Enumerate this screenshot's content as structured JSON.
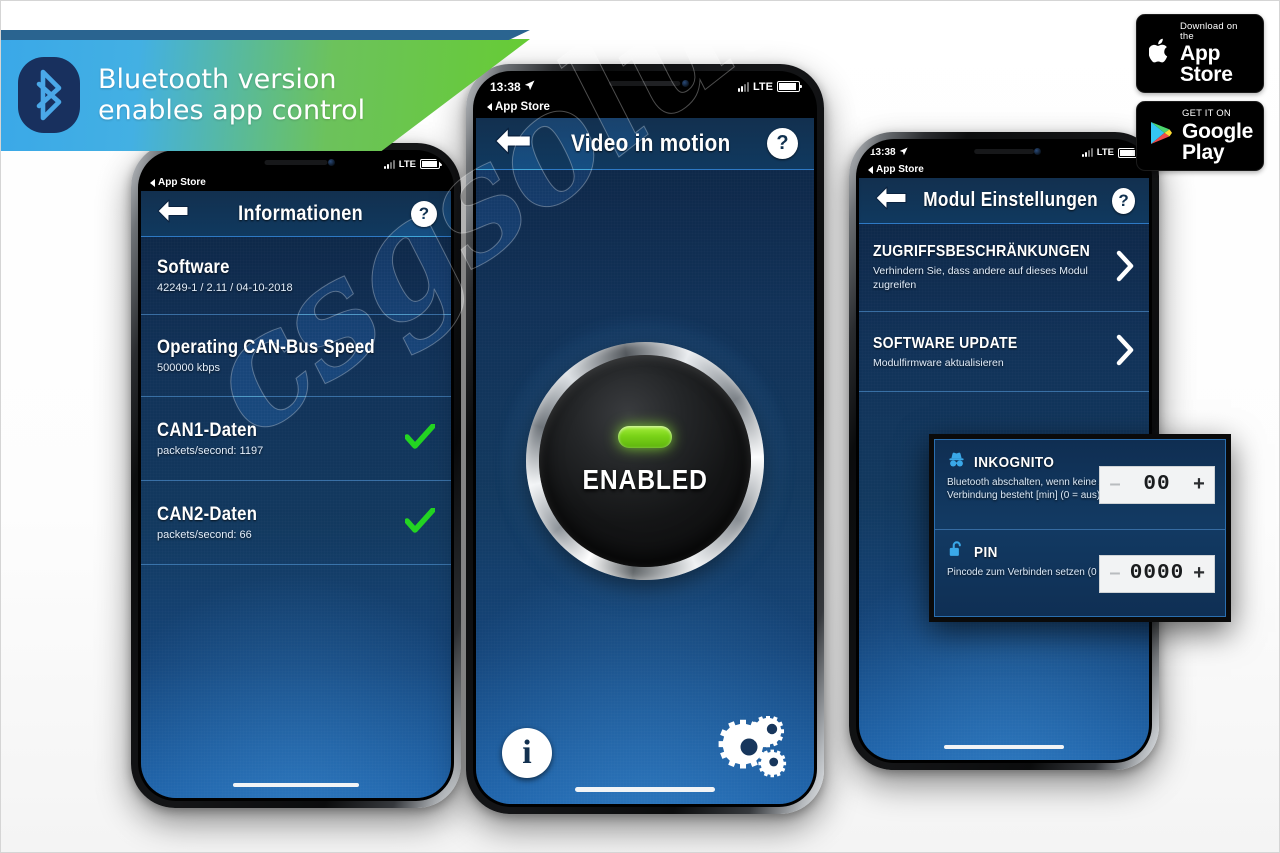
{
  "banner": {
    "line1": "Bluetooth version",
    "line2": "enables app control",
    "icon": "bluetooth-icon",
    "color_start": "#3aa8e8",
    "color_end": "#66cc33"
  },
  "badges": [
    {
      "name": "app-store-badge",
      "small": "Download on the",
      "big": "App Store",
      "icon": "apple-logo-icon"
    },
    {
      "name": "google-play-badge",
      "small": "GET IT ON",
      "big": "Google Play",
      "icon": "google-play-triangle-icon"
    }
  ],
  "watermark": {
    "text": "csgsolutions"
  },
  "phone_left": {
    "status": {
      "time": "",
      "carrier_back": "App Store",
      "network": "LTE"
    },
    "navbar": {
      "title": "Informationen",
      "back_icon": "back-arrow-icon",
      "help_icon": "help-question-icon"
    },
    "rows": [
      {
        "title": "Software",
        "sub": "42249-1 / 2.11 / 04-10-2018",
        "accessory": "none"
      },
      {
        "title": "Operating CAN-Bus Speed",
        "sub": "500000 kbps",
        "accessory": "none"
      },
      {
        "title": "CAN1-Daten",
        "sub": "packets/second: 1197",
        "accessory": "check"
      },
      {
        "title": "CAN2-Daten",
        "sub": "packets/second: 66",
        "accessory": "check"
      }
    ]
  },
  "phone_center": {
    "status": {
      "time": "13:38",
      "carrier_back": "App Store",
      "network": "LTE"
    },
    "navbar": {
      "title": "Video in motion",
      "back_icon": "back-arrow-icon",
      "help_icon": "help-question-icon"
    },
    "knob": {
      "label": "ENABLED",
      "led_color": "#7ad318",
      "state": "on"
    },
    "bottom": {
      "info_icon": "info-circle-icon",
      "settings_icon": "gears-icon"
    }
  },
  "phone_right": {
    "status": {
      "time": "13:38",
      "carrier_back": "App Store",
      "network": "LTE"
    },
    "navbar": {
      "title": "Modul Einstellungen",
      "back_icon": "back-arrow-icon",
      "help_icon": "help-question-icon"
    },
    "rows": [
      {
        "title": "ZUGRIFFSBESCHRÄNKUNGEN",
        "sub": "Verhindern Sie, dass andere auf dieses Modul zugreifen",
        "accessory": "chevron"
      },
      {
        "title": "SOFTWARE UPDATE",
        "sub": "Modulfirmware aktualisieren",
        "accessory": "chevron"
      }
    ]
  },
  "popup": {
    "rows": [
      {
        "icon": "incognito-hat-icon",
        "title": "INKOGNITO",
        "desc": "Bluetooth abschalten, wenn keine App-Verbindung besteht [min] (0 = aus)",
        "value": "00",
        "minus": "–",
        "plus": "+"
      },
      {
        "icon": "unlocked-padlock-icon",
        "title": "PIN",
        "desc": "Pincode zum Verbinden setzen (0 = aus)",
        "value": "0000",
        "minus": "–",
        "plus": "+"
      }
    ]
  }
}
